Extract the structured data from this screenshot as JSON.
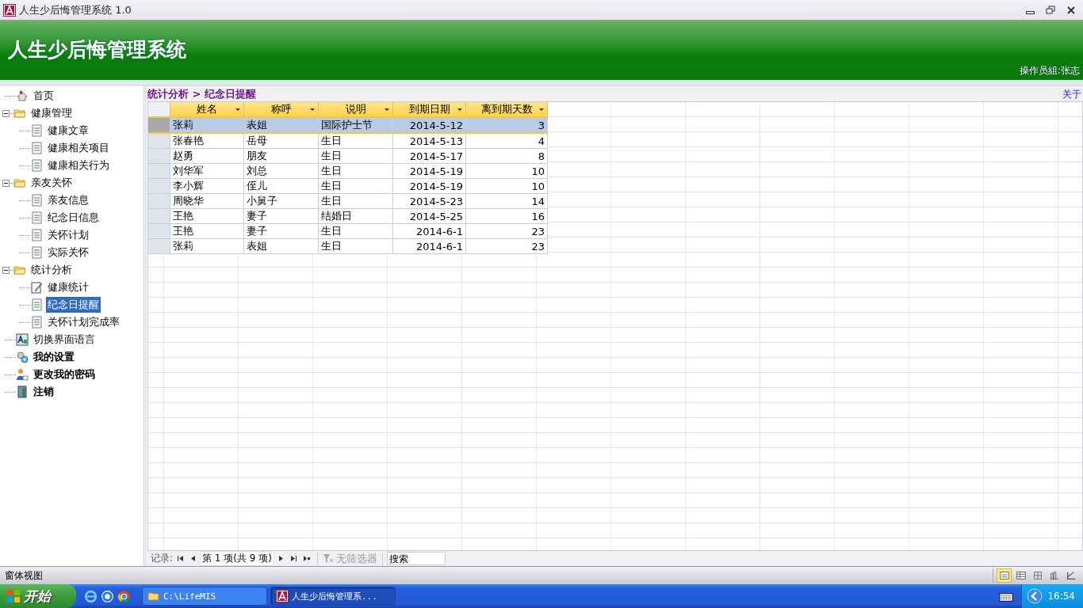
{
  "window": {
    "title": "人生少后悔管理系统 1.0"
  },
  "banner": {
    "title": "人生少后悔管理系统",
    "operator": "操作员組:张志"
  },
  "sidebar": {
    "items": [
      {
        "label": "首页",
        "kind": "home",
        "bold": false,
        "selected": false
      },
      {
        "label": "健康管理",
        "kind": "folder",
        "bold": false,
        "selected": false,
        "expanded": true,
        "children": [
          {
            "label": "健康文章",
            "kind": "document",
            "bold": false,
            "selected": false
          },
          {
            "label": "健康相关项目",
            "kind": "document",
            "bold": false,
            "selected": false
          },
          {
            "label": "健康相关行为",
            "kind": "document",
            "bold": false,
            "selected": false
          }
        ]
      },
      {
        "label": "亲友关怀",
        "kind": "folder",
        "bold": false,
        "selected": false,
        "expanded": true,
        "children": [
          {
            "label": "亲友信息",
            "kind": "document",
            "bold": false,
            "selected": false
          },
          {
            "label": "纪念日信息",
            "kind": "document",
            "bold": false,
            "selected": false
          },
          {
            "label": "关怀计划",
            "kind": "document",
            "bold": false,
            "selected": false
          },
          {
            "label": "实际关怀",
            "kind": "document",
            "bold": false,
            "selected": false
          }
        ]
      },
      {
        "label": "统计分析",
        "kind": "folder",
        "bold": false,
        "selected": false,
        "expanded": true,
        "children": [
          {
            "label": "健康统计",
            "kind": "edit",
            "bold": false,
            "selected": false
          },
          {
            "label": "纪念日提醒",
            "kind": "document",
            "bold": false,
            "selected": true
          },
          {
            "label": "关怀计划完成率",
            "kind": "document",
            "bold": false,
            "selected": false
          }
        ]
      },
      {
        "label": "切换界面语言",
        "kind": "language",
        "bold": false,
        "selected": false
      },
      {
        "label": "我的设置",
        "kind": "settings",
        "bold": true,
        "selected": false
      },
      {
        "label": "更改我的密码",
        "kind": "password",
        "bold": true,
        "selected": false
      },
      {
        "label": "注销",
        "kind": "logout",
        "bold": true,
        "selected": false
      }
    ]
  },
  "breadcrumb": "统计分析 > 纪念日提醒",
  "about_link": "关于",
  "table": {
    "columns": [
      {
        "label": "姓名",
        "kind": "text"
      },
      {
        "label": "称呼",
        "kind": "text"
      },
      {
        "label": "说明",
        "kind": "text"
      },
      {
        "label": "到期日期",
        "kind": "date"
      },
      {
        "label": "离到期天数",
        "kind": "number"
      }
    ],
    "rows": [
      {
        "cells": [
          "张莉",
          "表姐",
          "国际护士节",
          "2014-5-12",
          "3"
        ],
        "selected": true
      },
      {
        "cells": [
          "张春艳",
          "岳母",
          "生日",
          "2014-5-13",
          "4"
        ],
        "selected": false
      },
      {
        "cells": [
          "赵勇",
          "朋友",
          "生日",
          "2014-5-17",
          "8"
        ],
        "selected": false
      },
      {
        "cells": [
          "刘华军",
          "刘总",
          "生日",
          "2014-5-19",
          "10"
        ],
        "selected": false
      },
      {
        "cells": [
          "李小辉",
          "侄儿",
          "生日",
          "2014-5-19",
          "10"
        ],
        "selected": false
      },
      {
        "cells": [
          "周晓华",
          "小舅子",
          "生日",
          "2014-5-23",
          "14"
        ],
        "selected": false
      },
      {
        "cells": [
          "王艳",
          "妻子",
          "结婚日",
          "2014-5-25",
          "16"
        ],
        "selected": false
      },
      {
        "cells": [
          "王艳",
          "妻子",
          "生日",
          "2014-6-1",
          "23"
        ],
        "selected": false
      },
      {
        "cells": [
          "张莉",
          "表姐",
          "生日",
          "2014-6-1",
          "23"
        ],
        "selected": false
      }
    ]
  },
  "record_nav": {
    "label": "记录:",
    "position": "第 1 项(共 9 项)",
    "filter": {
      "label": "无筛选器",
      "disabled": true
    },
    "search": {
      "placeholder": "搜索"
    }
  },
  "status_bar": {
    "text": "窗体视图",
    "views": [
      {
        "kind": "form",
        "selected": true
      },
      {
        "kind": "datasheet",
        "selected": false
      },
      {
        "kind": "pivot",
        "selected": false
      },
      {
        "kind": "chart",
        "selected": false
      },
      {
        "kind": "design",
        "selected": false
      }
    ]
  },
  "taskbar": {
    "start": "开始",
    "tasks": [
      {
        "label": "C:\\LifeMIS",
        "kind": "folder",
        "selected": false
      },
      {
        "label": "人生少后悔管理系...",
        "kind": "access",
        "selected": true
      }
    ],
    "clock": "16:54"
  }
}
